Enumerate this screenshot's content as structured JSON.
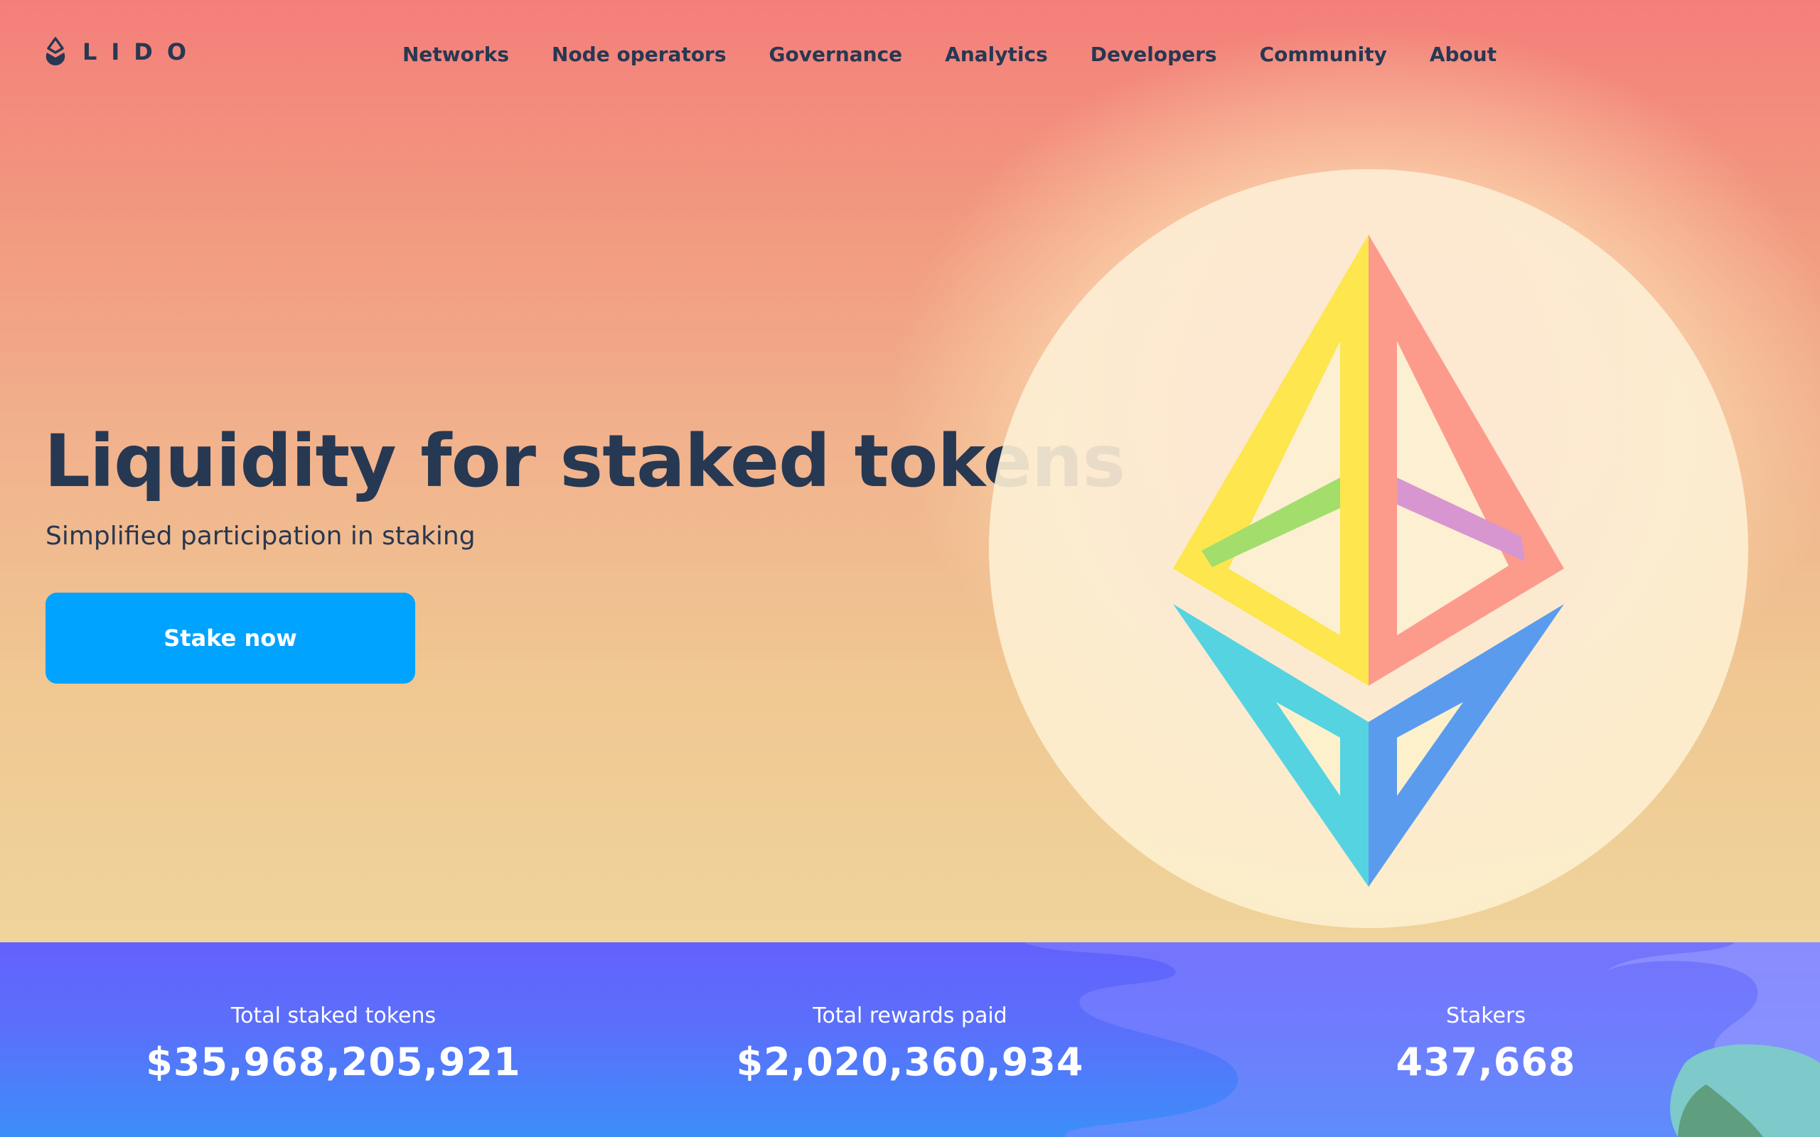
{
  "header": {
    "brand": "LIDO",
    "nav": [
      {
        "label": "Networks"
      },
      {
        "label": "Node operators"
      },
      {
        "label": "Governance"
      },
      {
        "label": "Analytics"
      },
      {
        "label": "Developers"
      },
      {
        "label": "Community"
      },
      {
        "label": "About"
      }
    ]
  },
  "hero": {
    "title": "Liquidity for staked tokens",
    "subtitle": "Simplified participation in staking",
    "cta_label": "Stake now"
  },
  "stats": [
    {
      "label": "Total staked tokens",
      "value": "$35,968,205,921"
    },
    {
      "label": "Total rewards paid",
      "value": "$2,020,360,934"
    },
    {
      "label": "Stakers",
      "value": "437,668"
    }
  ],
  "colors": {
    "accent": "#00a3ff",
    "text": "#273852",
    "band_top": "#6461fc",
    "band_bottom": "#3c8ef9"
  }
}
